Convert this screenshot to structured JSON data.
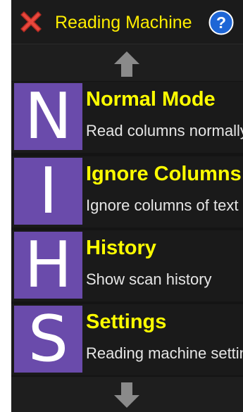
{
  "titlebar": {
    "title": "Reading Machine",
    "close_icon": "close-icon",
    "help_icon": "help-icon",
    "help_glyph": "?"
  },
  "scroll": {
    "up_icon": "arrow-up-icon",
    "down_icon": "arrow-down-icon"
  },
  "menu": {
    "items": [
      {
        "letter": "N",
        "title": "Normal Mode",
        "description": "Read columns normally"
      },
      {
        "letter": "I",
        "title": "Ignore Columns",
        "description": "Ignore columns of text"
      },
      {
        "letter": "H",
        "title": "History",
        "description": "Show scan history"
      },
      {
        "letter": "S",
        "title": "Settings",
        "description": "Reading machine settings"
      }
    ]
  },
  "colors": {
    "title_text": "#ffee00",
    "item_title": "#ffff00",
    "tile": "#6a4bab",
    "background": "#141414",
    "help_badge": "#1e66d6",
    "close": "#e8473c"
  }
}
